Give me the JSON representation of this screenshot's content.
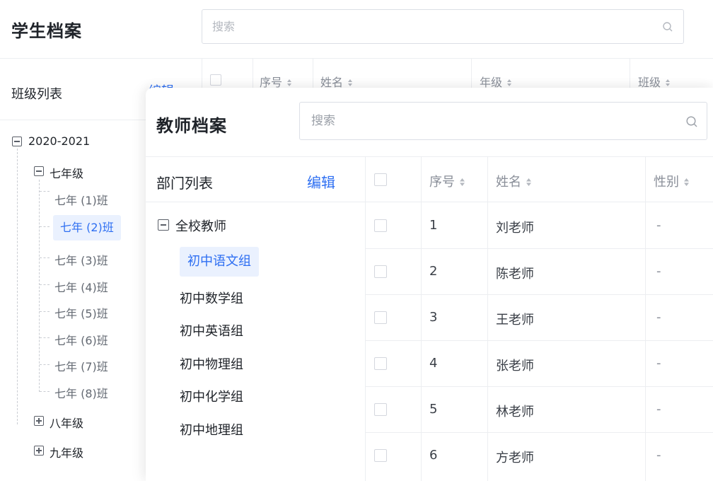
{
  "student_window": {
    "title": "学生档案",
    "search_placeholder": "搜索",
    "sidebar": {
      "title": "班级列表",
      "edit_label": "编辑"
    },
    "table_headers": [
      "序号",
      "姓名",
      "年级",
      "班级"
    ],
    "tree": {
      "year": "2020-2021",
      "grades": [
        {
          "label": "七年级",
          "expanded": true,
          "classes": [
            "七年 (1)班",
            "七年 (2)班",
            "七年 (3)班",
            "七年 (4)班",
            "七年 (5)班",
            "七年 (6)班",
            "七年 (7)班",
            "七年 (8)班"
          ],
          "selected_class": "七年 (2)班"
        },
        {
          "label": "八年级",
          "expanded": false
        },
        {
          "label": "九年级",
          "expanded": false
        }
      ]
    }
  },
  "teacher_window": {
    "title": "教师档案",
    "search_placeholder": "搜索",
    "sidebar": {
      "title": "部门列表",
      "edit_label": "编辑",
      "root": "全校教师",
      "departments": [
        "初中语文组",
        "初中数学组",
        "初中英语组",
        "初中物理组",
        "初中化学组",
        "初中地理组"
      ],
      "selected_department": "初中语文组"
    },
    "table": {
      "headers": [
        "序号",
        "姓名",
        "性别"
      ],
      "rows": [
        {
          "index": "1",
          "name": "刘老师",
          "gender": "-"
        },
        {
          "index": "2",
          "name": "陈老师",
          "gender": "-"
        },
        {
          "index": "3",
          "name": "王老师",
          "gender": "-"
        },
        {
          "index": "4",
          "name": "张老师",
          "gender": "-"
        },
        {
          "index": "5",
          "name": "林老师",
          "gender": "-"
        },
        {
          "index": "6",
          "name": "方老师",
          "gender": "-"
        }
      ]
    }
  },
  "colors": {
    "accent": "#2e6ff2",
    "selected_bg": "#eaf1fe",
    "border": "#eceef1",
    "muted_text": "#8a8f99"
  },
  "icons": {
    "search": "search-icon",
    "sort": "sort-icon",
    "collapse": "minus-box-icon",
    "expand": "plus-box-icon"
  }
}
